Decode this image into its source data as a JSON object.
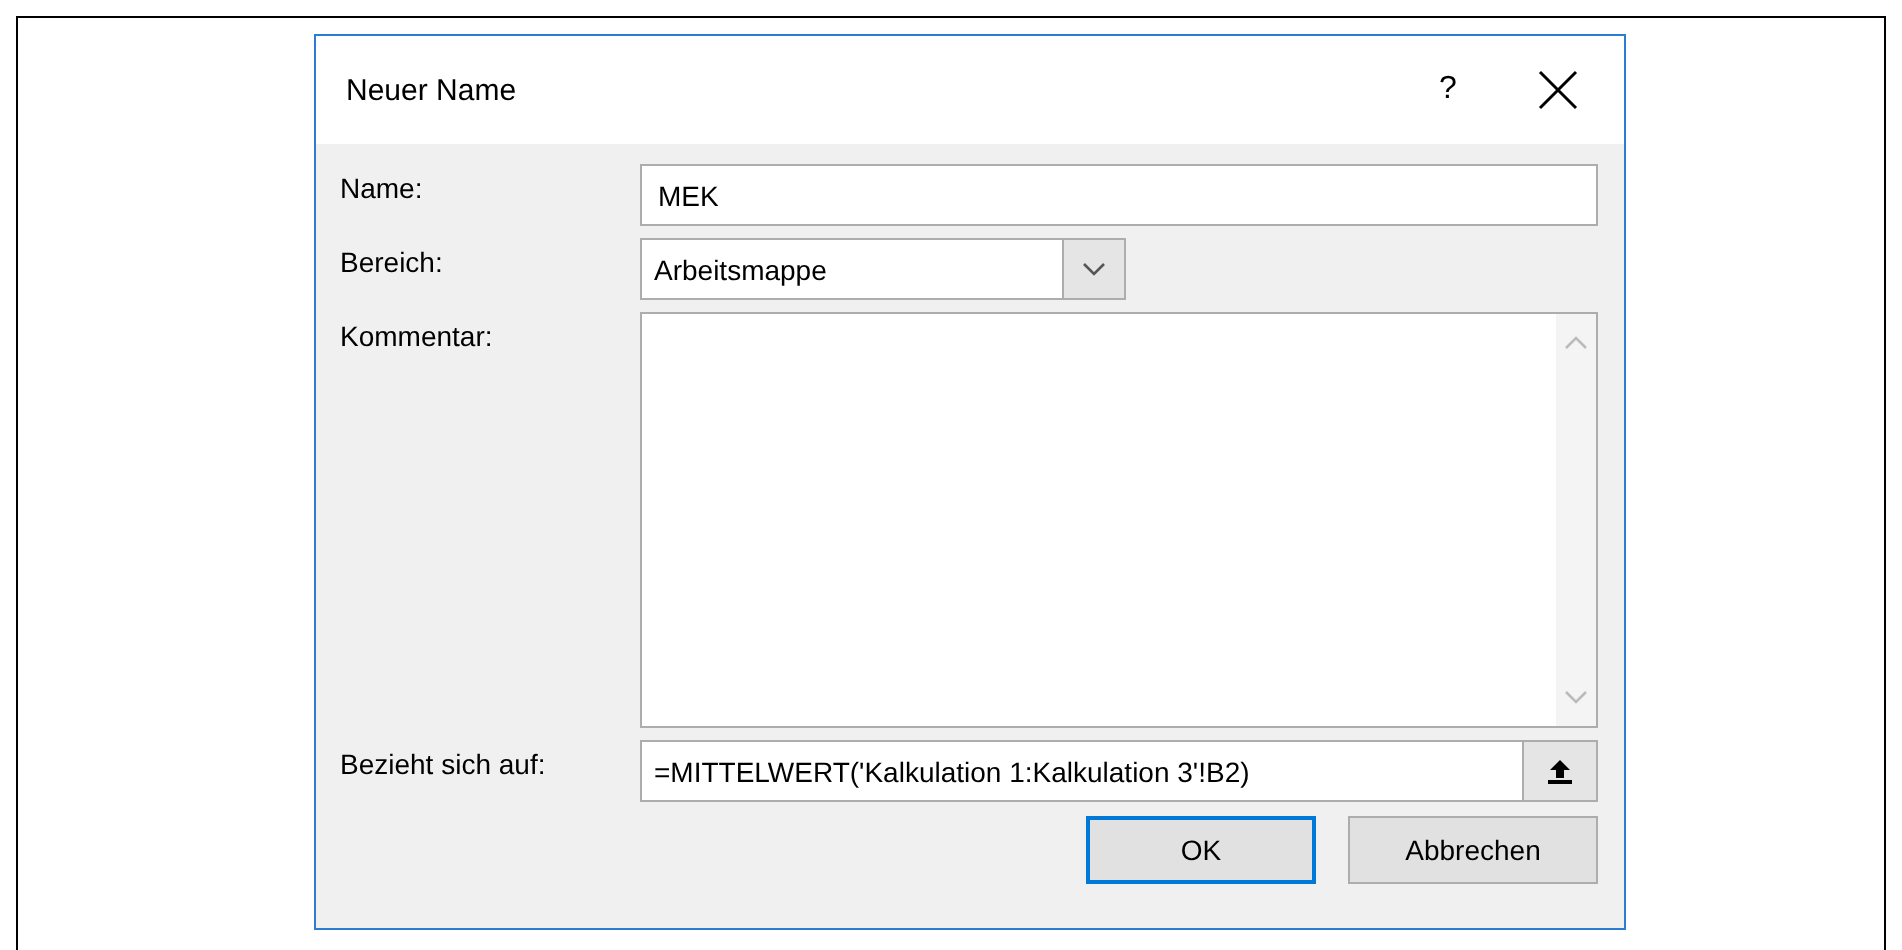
{
  "window": {
    "title": "Neuer Name",
    "help_glyph": "?"
  },
  "fields": [
    {
      "kind": "text",
      "label": "Name:",
      "value": "MEK"
    },
    {
      "kind": "dropdown",
      "label": "Bereich:",
      "value": "Arbeitsmappe"
    },
    {
      "kind": "textarea",
      "label": "Kommentar:"
    },
    {
      "kind": "reference",
      "label": "Bezieht sich auf:",
      "value": "=MITTELWERT('Kalkulation 1:Kalkulation 3'!B2)"
    }
  ],
  "buttons": [
    {
      "label": "OK",
      "default": true
    },
    {
      "label": "Abbrechen",
      "default": false
    }
  ]
}
